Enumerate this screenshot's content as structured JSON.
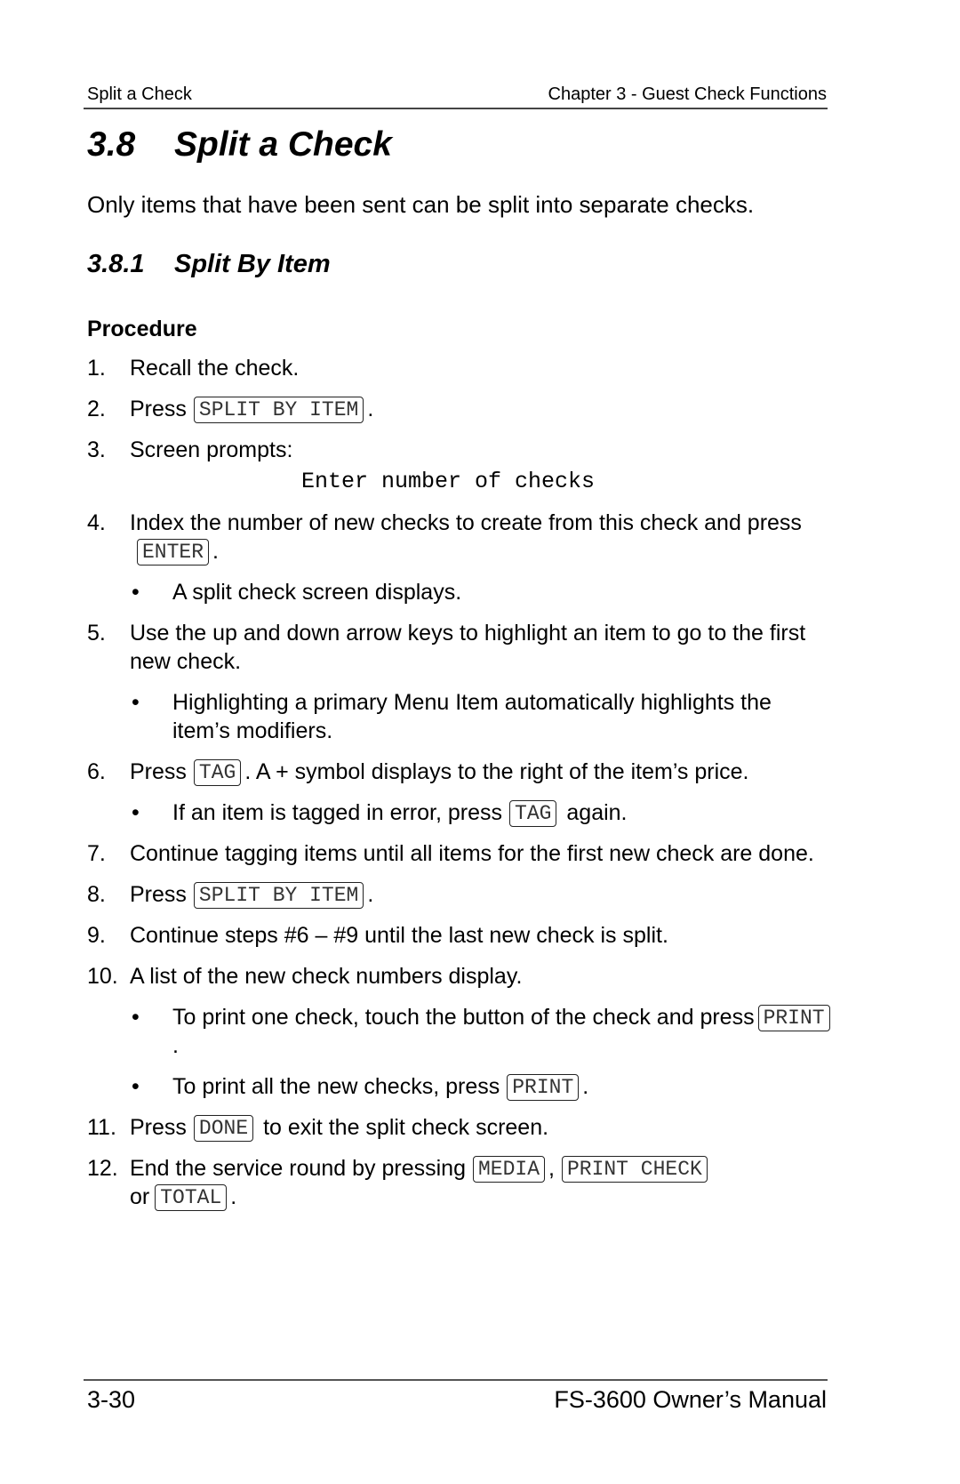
{
  "header": {
    "left": "Split a Check",
    "right": "Chapter 3 - Guest Check Functions"
  },
  "section": {
    "number": "3.8",
    "title": "Split a Check"
  },
  "intro": "Only items that have been sent can be split into separate checks.",
  "subsection": {
    "number": "3.8.1",
    "title": "Split By Item"
  },
  "procedure_label": "Procedure",
  "steps": {
    "s1": {
      "n": "1.",
      "text": "Recall the check."
    },
    "s2": {
      "n": "2.",
      "pre": "Press",
      "key": "SPLIT BY ITEM",
      "post": "."
    },
    "s3": {
      "n": "3.",
      "text": "Screen prompts:",
      "prompt": "Enter number of checks"
    },
    "s4": {
      "n": "4.",
      "pre": "Index the number of new checks to create from this check and press",
      "key": "ENTER",
      "post": ".",
      "bullet": "A split check screen displays."
    },
    "s5": {
      "n": "5.",
      "text": "Use the up and down arrow keys to highlight an item to go to the first new check.",
      "bullet": "Highlighting a primary Menu Item automatically highlights the item’s modifiers."
    },
    "s6": {
      "n": "6.",
      "pre": "Press",
      "key": "TAG",
      "post": ".  A + symbol displays to the right of the item’s price.",
      "bullet_pre": "If an item is tagged in error, press",
      "bullet_key": "TAG",
      "bullet_post": "again."
    },
    "s7": {
      "n": "7.",
      "text": "Continue tagging items until all items for the first new check are done."
    },
    "s8": {
      "n": "8.",
      "pre": "Press",
      "key": "SPLIT BY ITEM",
      "post": "."
    },
    "s9": {
      "n": "9.",
      "text": "Continue steps #6 – #9 until the last new check is split."
    },
    "s10": {
      "n": "10.",
      "text": "A list of the new check numbers display.",
      "bullet1_pre": "To print one check, touch the button of the check and press",
      "bullet1_key": "PRINT",
      "bullet1_post": ".",
      "bullet2_pre": "To print all the new checks, press",
      "bullet2_key": "PRINT",
      "bullet2_post": "."
    },
    "s11": {
      "n": "11.",
      "pre": "Press",
      "key": "DONE",
      "post": "to exit the split check screen."
    },
    "s12": {
      "n": "12.",
      "pre": "End the service round by pressing",
      "key1": "MEDIA",
      "mid1": ",",
      "key2": "PRINT CHECK",
      "mid2": "or",
      "key3": "TOTAL",
      "post": "."
    }
  },
  "bullet_glyph": "•",
  "footer": {
    "left": "3-30",
    "right": "FS-3600 Owner’s Manual"
  }
}
